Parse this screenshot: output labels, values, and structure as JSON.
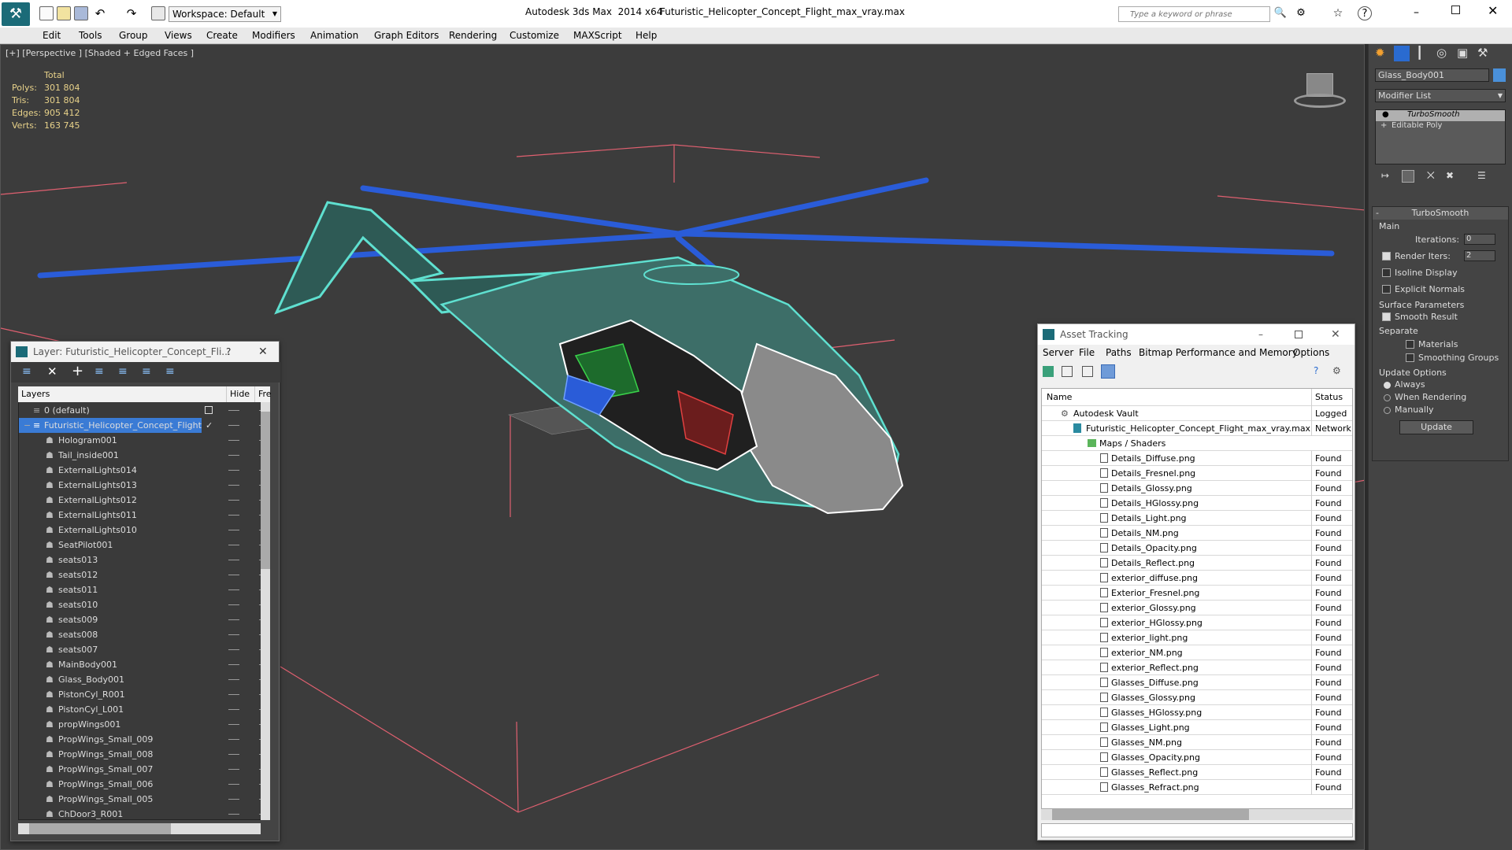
{
  "titlebar": {
    "app_title": "Autodesk 3ds Max  2014 x64",
    "file_title": "Futuristic_Helicopter_Concept_Flight_max_vray.max",
    "workspace": "Workspace: Default",
    "search_placeholder": "Type a keyword or phrase"
  },
  "menu": [
    "Edit",
    "Tools",
    "Group",
    "Views",
    "Create",
    "Modifiers",
    "Animation",
    "Graph Editors",
    "Rendering",
    "Customize",
    "MAXScript",
    "Help"
  ],
  "viewport": {
    "label": "[+] [Perspective ] [Shaded + Edged Faces ]",
    "stats_header": "Total",
    "stats": [
      {
        "label": "Polys:",
        "value": "301 804"
      },
      {
        "label": "Tris:",
        "value": "301 804"
      },
      {
        "label": "Edges:",
        "value": "905 412"
      },
      {
        "label": "Verts:",
        "value": "163 745"
      }
    ]
  },
  "layer_window": {
    "title": "Layer: Futuristic_Helicopter_Concept_Fli...",
    "help": "?",
    "col_layers": "Layers",
    "col_hide": "Hide",
    "col_freeze": "Fre",
    "default_layer": "0 (default)",
    "parent_layer": "Futuristic_Helicopter_Concept_Flight",
    "items": [
      "Hologram001",
      "Tail_inside001",
      "ExternalLights014",
      "ExternalLights013",
      "ExternalLights012",
      "ExternalLights011",
      "ExternalLights010",
      "SeatPilot001",
      "seats013",
      "seats012",
      "seats011",
      "seats010",
      "seats009",
      "seats008",
      "seats007",
      "MainBody001",
      "Glass_Body001",
      "PistonCyl_R001",
      "PistonCyl_L001",
      "propWings001",
      "PropWings_Small_009",
      "PropWings_Small_008",
      "PropWings_Small_007",
      "PropWings_Small_006",
      "PropWings_Small_005",
      "ChDoor3_R001"
    ]
  },
  "asset_window": {
    "title": "Asset Tracking",
    "menu": [
      "Server",
      "File",
      "Paths",
      "Bitmap Performance and Memory",
      "Options"
    ],
    "col_name": "Name",
    "col_status": "Status",
    "vault": {
      "name": "Autodesk Vault",
      "status": "Logged"
    },
    "maxfile": {
      "name": "Futuristic_Helicopter_Concept_Flight_max_vray.max",
      "status": "Network"
    },
    "maps_folder": "Maps / Shaders",
    "files": [
      {
        "name": "Details_Diffuse.png",
        "status": "Found"
      },
      {
        "name": "Details_Fresnel.png",
        "status": "Found"
      },
      {
        "name": "Details_Glossy.png",
        "status": "Found"
      },
      {
        "name": "Details_HGlossy.png",
        "status": "Found"
      },
      {
        "name": "Details_Light.png",
        "status": "Found"
      },
      {
        "name": "Details_NM.png",
        "status": "Found"
      },
      {
        "name": "Details_Opacity.png",
        "status": "Found"
      },
      {
        "name": "Details_Reflect.png",
        "status": "Found"
      },
      {
        "name": "exterior_diffuse.png",
        "status": "Found"
      },
      {
        "name": "Exterior_Fresnel.png",
        "status": "Found"
      },
      {
        "name": "exterior_Glossy.png",
        "status": "Found"
      },
      {
        "name": "exterior_HGlossy.png",
        "status": "Found"
      },
      {
        "name": "exterior_light.png",
        "status": "Found"
      },
      {
        "name": "exterior_NM.png",
        "status": "Found"
      },
      {
        "name": "exterior_Reflect.png",
        "status": "Found"
      },
      {
        "name": "Glasses_Diffuse.png",
        "status": "Found"
      },
      {
        "name": "Glasses_Glossy.png",
        "status": "Found"
      },
      {
        "name": "Glasses_HGlossy.png",
        "status": "Found"
      },
      {
        "name": "Glasses_Light.png",
        "status": "Found"
      },
      {
        "name": "Glasses_NM.png",
        "status": "Found"
      },
      {
        "name": "Glasses_Opacity.png",
        "status": "Found"
      },
      {
        "name": "Glasses_Reflect.png",
        "status": "Found"
      },
      {
        "name": "Glasses_Refract.png",
        "status": "Found"
      }
    ]
  },
  "command_panel": {
    "object_name": "Glass_Body001",
    "object_color": "#4a90d9",
    "modifier_list": "Modifier List",
    "stack": [
      "TurboSmooth",
      "Editable Poly"
    ],
    "rollout_title": "TurboSmooth",
    "main_group": "Main",
    "iterations_label": "Iterations:",
    "iterations_value": "0",
    "render_iters_label": "Render Iters:",
    "render_iters_value": "2",
    "isoline": "Isoline Display",
    "explicit_normals": "Explicit Normals",
    "surface_group": "Surface Parameters",
    "smooth_result": "Smooth Result",
    "separate": "Separate",
    "materials": "Materials",
    "smoothing_groups": "Smoothing Groups",
    "update_group": "Update Options",
    "always": "Always",
    "when_rendering": "When Rendering",
    "manually": "Manually",
    "update_button": "Update"
  },
  "colors": {
    "wire_body": "#5fe0d0",
    "wire_rotor": "#2a5cd8",
    "wire_glass": "#ffffff",
    "grid_lines": "#e06070",
    "selection": "#3a7bd5"
  }
}
